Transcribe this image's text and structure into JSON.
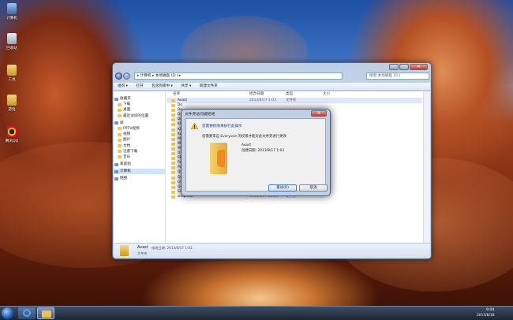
{
  "desktop_icons": [
    {
      "label": "计算机",
      "icon": "computer-icon"
    },
    {
      "label": "回收站",
      "icon": "recycle-bin-icon"
    },
    {
      "label": "工具",
      "icon": "tools-folder-icon"
    },
    {
      "label": "游戏",
      "icon": "games-folder-icon"
    },
    {
      "label": "腾讯QQ",
      "icon": "qq-icon"
    }
  ],
  "explorer": {
    "breadcrumb": "▸ 计算机 ▸ 本地磁盘 (D:) ▸",
    "search_placeholder": "搜索 本地磁盘 (D:)",
    "toolbar": [
      "组织 ▾",
      "打开",
      "包含到库中 ▾",
      "共享 ▾",
      "新建文件夹"
    ],
    "nav": [
      {
        "label": "收藏夹",
        "header": true
      },
      {
        "label": "下载"
      },
      {
        "label": "桌面"
      },
      {
        "label": "最近访问的位置"
      },
      {
        "label": "库",
        "header": true
      },
      {
        "label": "PPTV视频"
      },
      {
        "label": "视频"
      },
      {
        "label": "图片"
      },
      {
        "label": "文档"
      },
      {
        "label": "迅雷下载"
      },
      {
        "label": "音乐"
      },
      {
        "label": "家庭组",
        "header": true
      },
      {
        "label": "计算机",
        "header": true
      },
      {
        "label": "网络",
        "header": true
      }
    ],
    "columns": {
      "name": "名称",
      "date": "修改日期",
      "type": "类型",
      "size": "大小"
    },
    "files": [
      {
        "name": "Avast",
        "date": "2013/8/17 1:03",
        "type": "文件夹"
      },
      {
        "name": "Do",
        "date": "",
        "type": ""
      },
      {
        "name": "Do",
        "date": "",
        "type": ""
      },
      {
        "name": "Dr",
        "date": "",
        "type": ""
      },
      {
        "name": "Dr",
        "date": "",
        "type": ""
      },
      {
        "name": "Kl",
        "date": "",
        "type": ""
      },
      {
        "name": "Kl",
        "date": "",
        "type": ""
      },
      {
        "name": "Ku",
        "date": "",
        "type": ""
      },
      {
        "name": "MM",
        "date": "",
        "type": ""
      },
      {
        "name": "My",
        "date": "",
        "type": ""
      },
      {
        "name": "My",
        "date": "",
        "type": ""
      },
      {
        "name": "OF",
        "date": "",
        "type": ""
      },
      {
        "name": "PP",
        "date": "",
        "type": ""
      },
      {
        "name": "Pr",
        "date": "",
        "type": ""
      },
      {
        "name": "Program Files",
        "date": "2013/8/17 1:00",
        "type": "文件夹"
      },
      {
        "name": "QQ2011",
        "date": "2013/1/4 13:01",
        "type": "文件夹"
      },
      {
        "name": "QQ2013",
        "date": "2013/8/17 21:25",
        "type": "文件夹"
      },
      {
        "name": "QQDownload",
        "date": "2013/4/5 10:24",
        "type": "文件夹"
      },
      {
        "name": "QQMusic",
        "date": "2013/8/17 21:11",
        "type": "文件夹"
      },
      {
        "name": "SinaLive",
        "date": "2013/8/17 21:34",
        "type": "文件夹"
      },
      {
        "name": "snapshot",
        "date": "2013/8/17 20:26",
        "type": "文件夹"
      }
    ],
    "status": {
      "name": "Avast",
      "detail": "修改日期: 2013/8/17 1:03",
      "type": "文件夹"
    }
  },
  "dialog": {
    "title": "文件夹访问被拒绝",
    "heading": "您需要权限来执行此操作",
    "message": "您需要来自 Everyone 的权限才能对此文件夹进行更改",
    "item_name": "Avast",
    "item_date": "创建日期: 2013/8/17 1:03",
    "retry": "重试(R)",
    "cancel": "取消"
  },
  "taskbar": {
    "time": "9:04",
    "date": "2013/8/18"
  }
}
